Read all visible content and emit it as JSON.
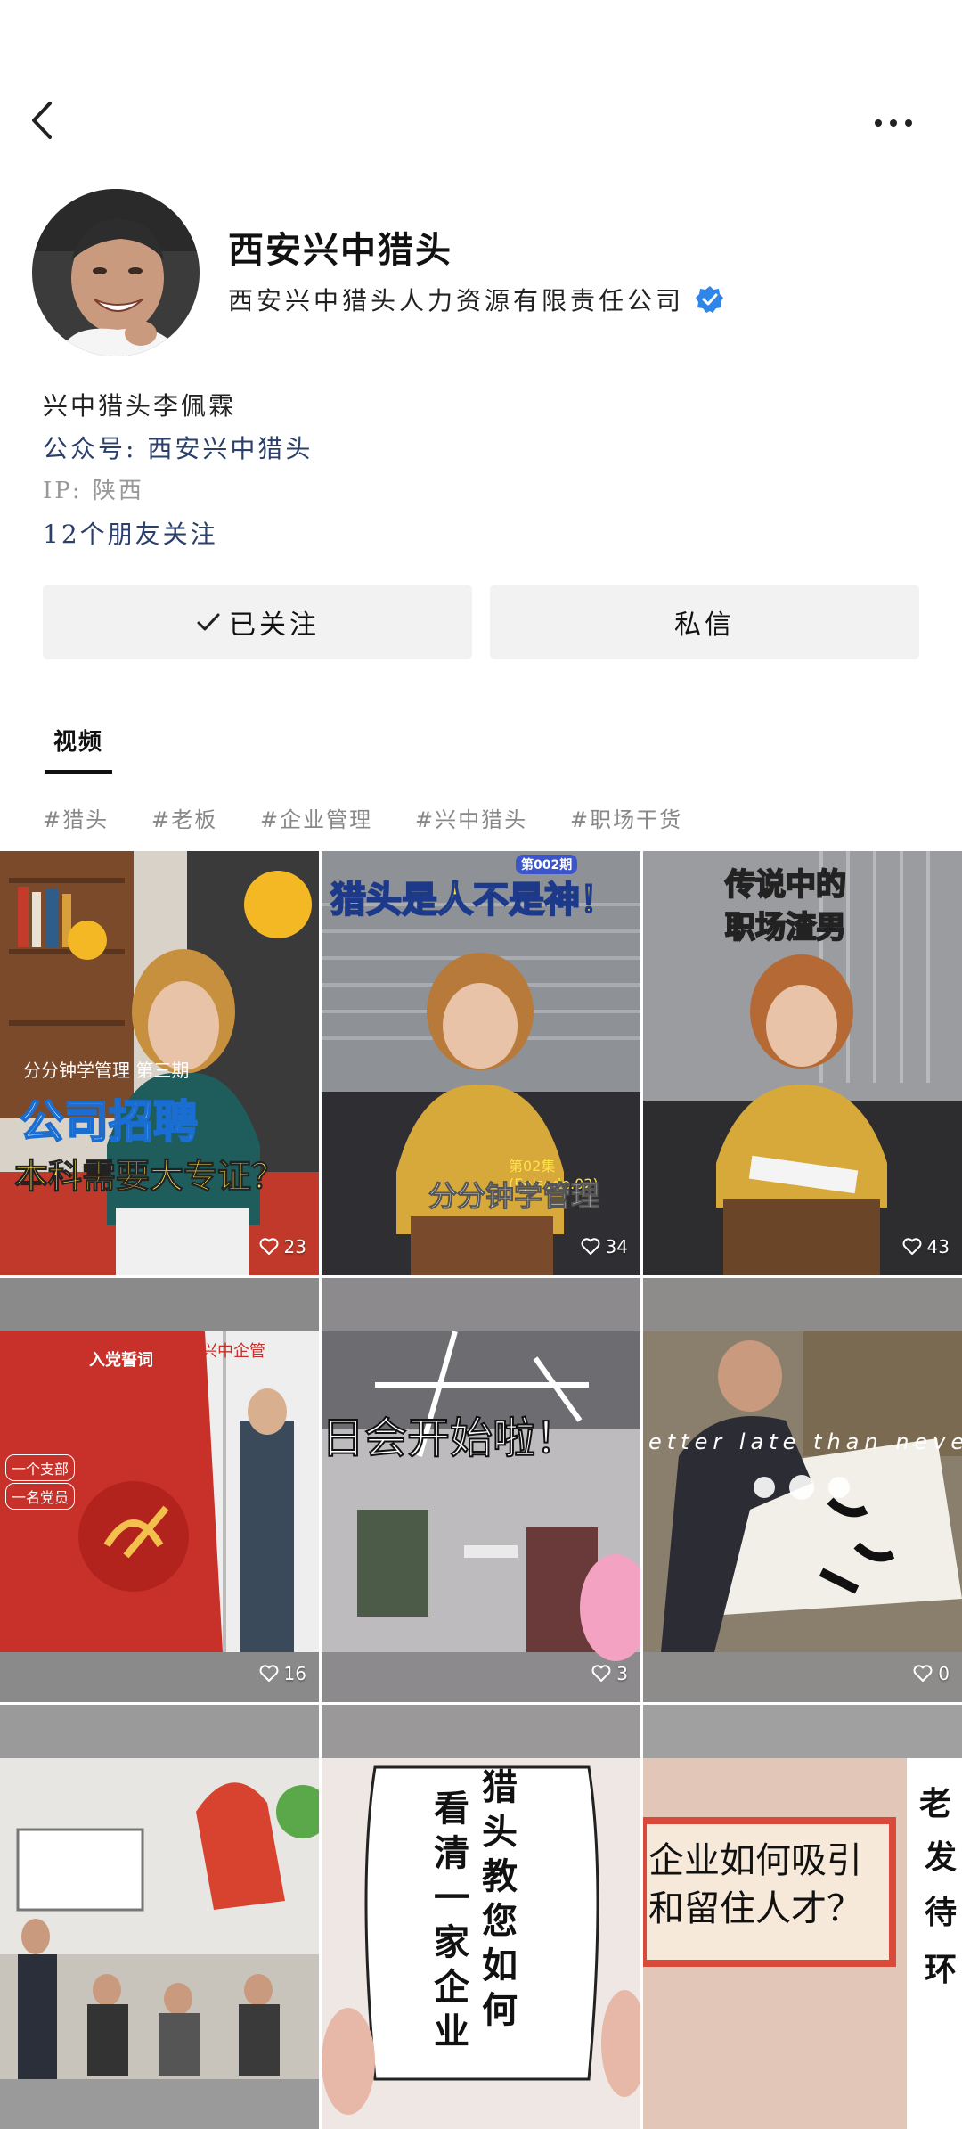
{
  "profile": {
    "name": "西安兴中猎头",
    "company": "西安兴中猎头人力资源有限责任公司",
    "bio_line": "兴中猎头李佩霖",
    "official_account": "公众号: 西安兴中猎头",
    "ip": "IP: 陕西",
    "friends_following": "12个朋友关注"
  },
  "actions": {
    "follow_label": "已关注",
    "message_label": "私信"
  },
  "tabs": [
    {
      "label": "视频"
    }
  ],
  "tags": [
    "#猎头",
    "#老板",
    "#企业管理",
    "#兴中猎头",
    "#职场干货"
  ],
  "videos": [
    {
      "likes": "23",
      "overlay": [
        "分分钟学管理  第三期",
        "公司招聘",
        "本科需要大专证？"
      ]
    },
    {
      "likes": "34",
      "overlay": [
        "猎头是人不是神！",
        "第02集(Episode.02)",
        "分分钟学管理",
        "第002期"
      ]
    },
    {
      "likes": "43",
      "overlay": [
        "传说中的",
        "职场渣男"
      ]
    },
    {
      "likes": "16",
      "overlay": [
        "兴中企管",
        "一个支部",
        "一名党员",
        "入党誓词"
      ]
    },
    {
      "likes": "3",
      "overlay": [
        "日会开始啦！"
      ]
    },
    {
      "likes": "0",
      "overlay": [
        "etter late than never"
      ]
    },
    {
      "likes": "",
      "overlay": []
    },
    {
      "likes": "",
      "overlay": [
        "猎头教您如何",
        "看清一家企业"
      ]
    },
    {
      "likes": "",
      "overlay": [
        "企业如何吸引",
        "和留住人才？",
        "老",
        "发",
        "待",
        "环"
      ]
    }
  ],
  "colors": {
    "link": "#2a3f6b",
    "verified": "#2f86e8",
    "tag": "#888888",
    "button_bg": "#f2f2f2"
  },
  "icons": {
    "back": "chevron-left-icon",
    "more": "more-dots-icon",
    "verified": "verified-badge-icon",
    "check": "check-icon",
    "heart": "heart-outline-icon"
  }
}
